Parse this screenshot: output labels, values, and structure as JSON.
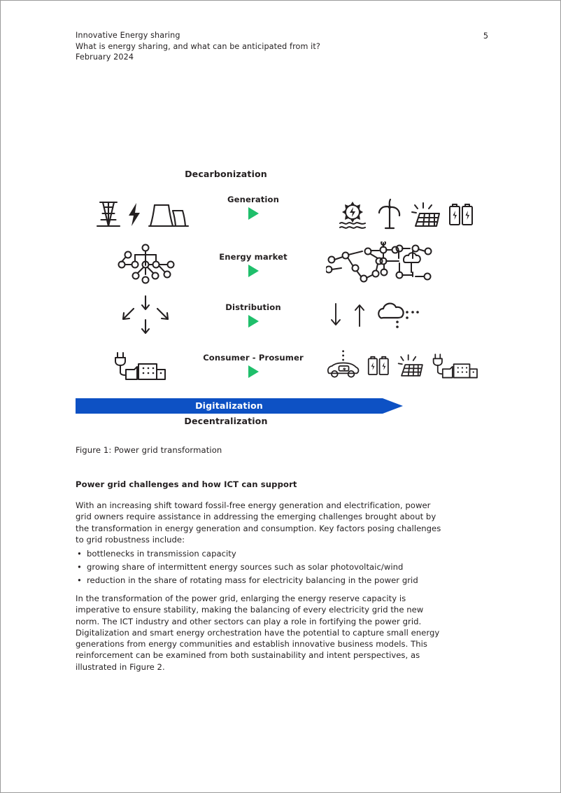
{
  "header": {
    "line1": "Innovative Energy sharing",
    "line2": "What is energy sharing, and what can be anticipated from it?",
    "line3": "February 2024",
    "page_number": "5"
  },
  "figure": {
    "title": "Decarbonization",
    "rows": [
      {
        "label": "Generation",
        "left_icons": [
          "transmission-tower-icon",
          "lightning-bolt-icon",
          "cooling-tower-icon"
        ],
        "arrow": "green-triangle-arrow",
        "right_icons": [
          "sun-hydro-icon",
          "wind-turbine-icon",
          "solar-panel-icon",
          "battery-pair-icon"
        ]
      },
      {
        "label": "Energy market",
        "left_icons": [
          "centralized-network-icon"
        ],
        "arrow": "green-triangle-arrow",
        "right_icons": [
          "distributed-mesh-network-icon"
        ]
      },
      {
        "label": "Distribution",
        "left_icons": [
          "diverging-arrows-icon"
        ],
        "arrow": "green-triangle-arrow",
        "right_icons": [
          "down-arrow-icon",
          "up-arrow-icon",
          "cloud-dots-icon"
        ]
      },
      {
        "label": "Consumer - Prosumer",
        "left_icons": [
          "plug-buildings-icon"
        ],
        "arrow": "green-triangle-arrow",
        "right_icons": [
          "electric-car-icon",
          "battery-pair-icon",
          "solar-panel-icon",
          "plug-buildings-icon"
        ]
      }
    ],
    "banner_label": "Digitalization",
    "footer_label": "Decentralization",
    "colors": {
      "banner_blue": "#0d51c4",
      "arrow_green": "#1fbf6b",
      "icon_black": "#231f20"
    }
  },
  "caption": "Figure 1: Power grid transformation",
  "subheading": "Power grid challenges and how ICT can support",
  "paragraphs": {
    "p1": "With an increasing shift toward fossil-free energy generation and electrification, power grid owners require assistance in addressing the emerging challenges brought about by the transformation in energy generation and consumption. Key factors posing challenges to grid robustness include:",
    "p2": "In the transformation of the power grid, enlarging the energy reserve capacity is imperative to ensure stability, making the balancing of every electricity grid the new norm. The ICT industry and other sectors can play a role in fortifying the power grid. Digitalization and smart energy orchestration have the potential to capture small energy generations from energy communities and establish innovative business models. This reinforcement can be examined from both sustainability and intent perspectives, as illustrated in Figure 2."
  },
  "bullets": [
    "bottlenecks in transmission capacity",
    "growing share of intermittent energy sources such as solar photovoltaic/wind",
    "reduction in the share of rotating mass for electricity balancing in the power grid"
  ]
}
